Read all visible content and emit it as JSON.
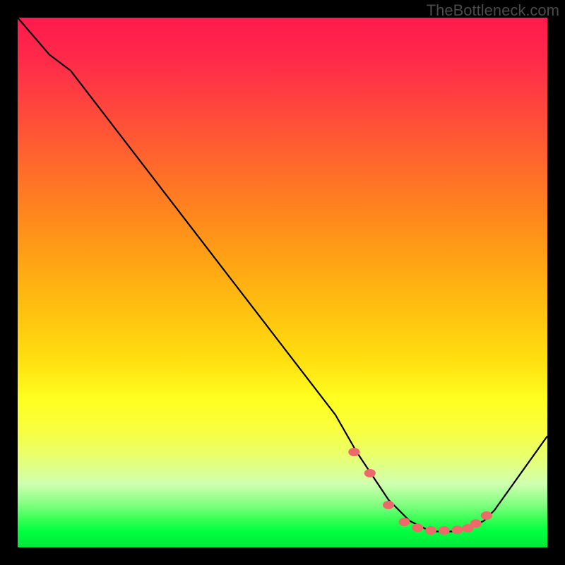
{
  "watermark": "TheBottleneck.com",
  "chart_data": {
    "type": "line",
    "title": "",
    "xlabel": "",
    "ylabel": "",
    "xlim": [
      0,
      100
    ],
    "ylim": [
      0,
      100
    ],
    "grid": false,
    "legend": false,
    "series": [
      {
        "name": "bottleneck-curve",
        "x": [
          0,
          6,
          10,
          20,
          30,
          40,
          50,
          60,
          64,
          66,
          70,
          74,
          78,
          82,
          85,
          88,
          90,
          100
        ],
        "y": [
          100,
          93,
          90,
          77,
          64,
          51,
          38,
          25,
          18,
          15,
          9,
          5,
          3,
          3,
          3.5,
          5,
          7,
          21
        ]
      }
    ],
    "markers": {
      "name": "highlight-points",
      "x": [
        63.5,
        66.5,
        70,
        73,
        75.5,
        78,
        80.5,
        83,
        85,
        86.5,
        88.5
      ],
      "y": [
        18,
        14,
        8,
        4.8,
        3.7,
        3.2,
        3.2,
        3.3,
        3.6,
        4.5,
        6
      ]
    },
    "colors": {
      "curve": "#000000",
      "marker": "#ed6a6a",
      "gradient_top": "#ff1a4d",
      "gradient_bottom": "#00e838"
    }
  }
}
